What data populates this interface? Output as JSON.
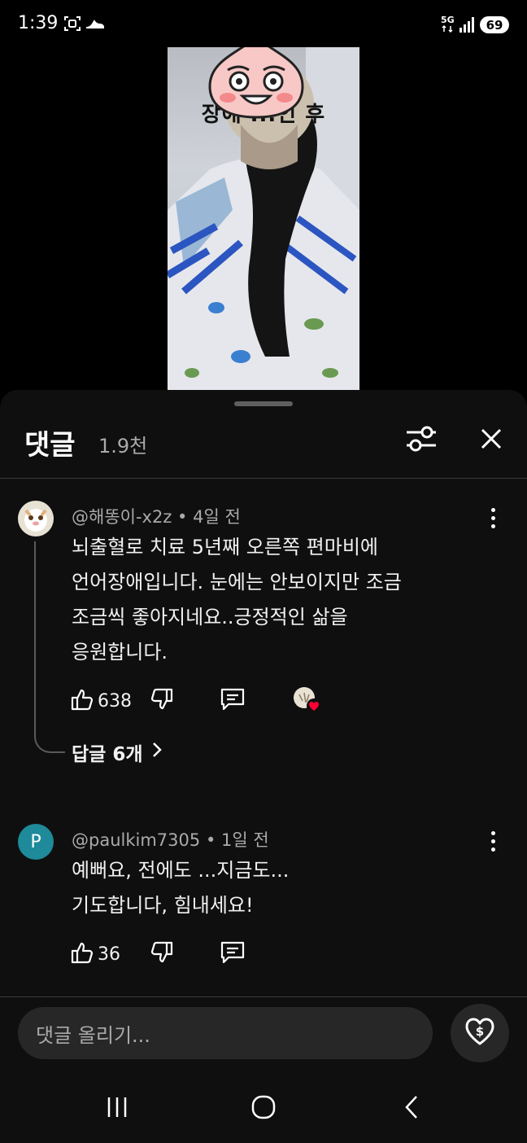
{
  "status_bar": {
    "time": "1:39",
    "network": "5G",
    "battery": "69",
    "icons": [
      "screenshot-icon",
      "shoe-icon",
      "network-5g-icon",
      "signal-icon"
    ]
  },
  "video": {
    "caption": "장애 ...인 후"
  },
  "comments_sheet": {
    "title": "댓글",
    "count": "1.9천",
    "comments": [
      {
        "author": "@해똥이-x2z",
        "time": "4일 전",
        "text_lines": [
          "뇌출혈로 치료 5년째 오른쪽 편마비에",
          "언어장애입니다. 눈에는 안보이지만 조금",
          "조금씩 좋아지네요..긍정적인 삶을",
          "응원합니다."
        ],
        "likes": "638",
        "replies_label": "답글 6개"
      },
      {
        "author": "@paulkim7305",
        "avatar_letter": "P",
        "time": "1일 전",
        "text_lines": [
          "예뻐요, 전에도 ...지금도...",
          "기도합니다, 힘내세요!"
        ],
        "likes": "36"
      }
    ],
    "input_placeholder": "댓글 올리기..."
  },
  "colors": {
    "sheet_bg": "#0f0f0f",
    "secondary_text": "#aaaaaa",
    "input_bg": "#272727",
    "heart_red": "#ff0033",
    "avatar_teal": "#1e8a9a"
  }
}
